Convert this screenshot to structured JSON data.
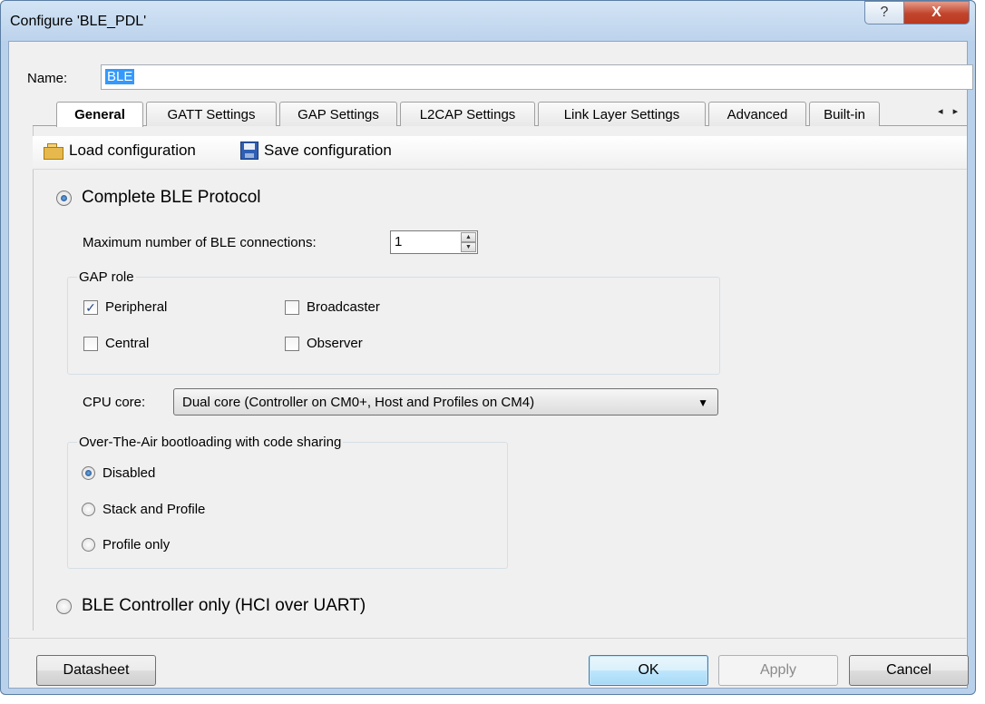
{
  "window": {
    "title": "Configure 'BLE_PDL'",
    "help_glyph": "?",
    "close_glyph": "X"
  },
  "name": {
    "label": "Name:",
    "value": "BLE"
  },
  "tabs": [
    {
      "label": "General",
      "active": true
    },
    {
      "label": "GATT Settings"
    },
    {
      "label": "GAP Settings"
    },
    {
      "label": "L2CAP Settings"
    },
    {
      "label": "Link Layer Settings"
    },
    {
      "label": "Advanced"
    },
    {
      "label": "Built-in"
    }
  ],
  "tab_scroll": "◂ ▸",
  "toolbar": {
    "load_label": "Load configuration",
    "save_label": "Save configuration",
    "load_icon": "folder-open-icon",
    "save_icon": "floppy-disk-icon"
  },
  "general": {
    "complete_label": "Complete BLE Protocol",
    "complete_selected": true,
    "max_conn_label": "Maximum number of BLE connections:",
    "max_conn_value": "1",
    "gap_role": {
      "title": "GAP role",
      "peripheral": "Peripheral",
      "peripheral_checked": true,
      "broadcaster": "Broadcaster",
      "broadcaster_checked": false,
      "central": "Central",
      "central_checked": false,
      "observer": "Observer",
      "observer_checked": false
    },
    "cpu_label": "CPU core:",
    "cpu_value": "Dual core (Controller on CM0+, Host and Profiles on CM4)",
    "ota": {
      "title": "Over-The-Air bootloading with code sharing",
      "disabled": "Disabled",
      "stack_profile": "Stack and Profile",
      "profile_only": "Profile only",
      "selected": "disabled"
    },
    "hci_label": "BLE Controller only (HCI over UART)"
  },
  "buttons": {
    "datasheet": "Datasheet",
    "ok": "OK",
    "apply": "Apply",
    "cancel": "Cancel"
  },
  "check_glyph": "✓"
}
